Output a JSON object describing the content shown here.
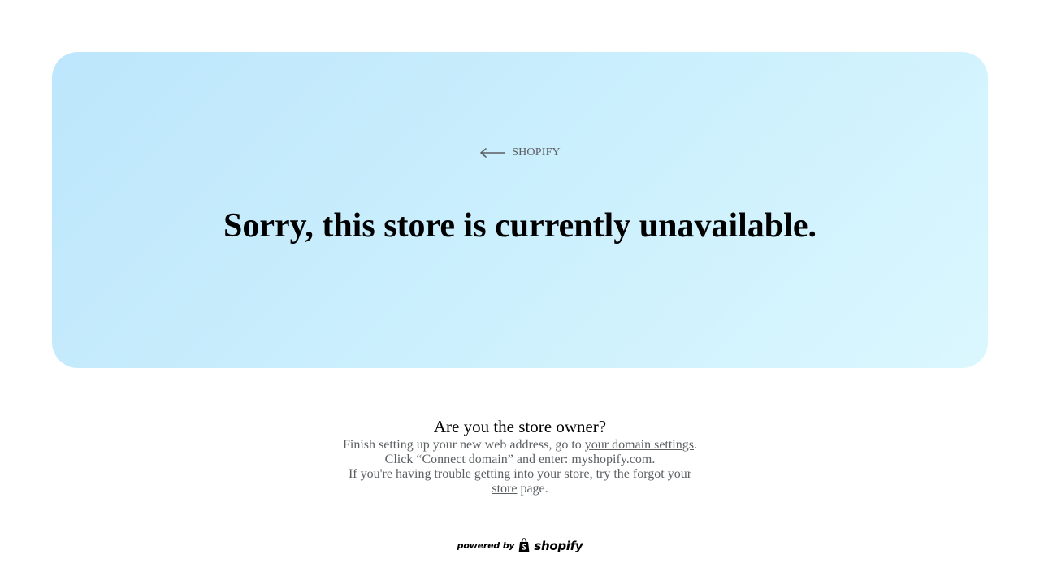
{
  "hero": {
    "back_link_label": "SHOPIFY",
    "title": "Sorry, this store is currently unavailable."
  },
  "owner": {
    "heading": "Are you the store owner?",
    "line1_prefix": "Finish setting up your new web address, go to ",
    "line1_link": "your domain settings",
    "line1_suffix": ".",
    "line2": "Click “Connect domain” and enter: myshopify.com.",
    "line3_prefix": "If you're having trouble getting into your store, try the ",
    "line3_link": "forgot your store",
    "line3_suffix": " page."
  },
  "footer": {
    "powered_by": "powered by",
    "brand": "shopify"
  },
  "icons": {
    "back": "arrow-left-icon",
    "bag": "shopify-bag-icon"
  },
  "colors": {
    "hero_gradient_start": "#bde6fc",
    "hero_gradient_end": "#dbf7fe",
    "muted_text": "#5c5f62"
  }
}
